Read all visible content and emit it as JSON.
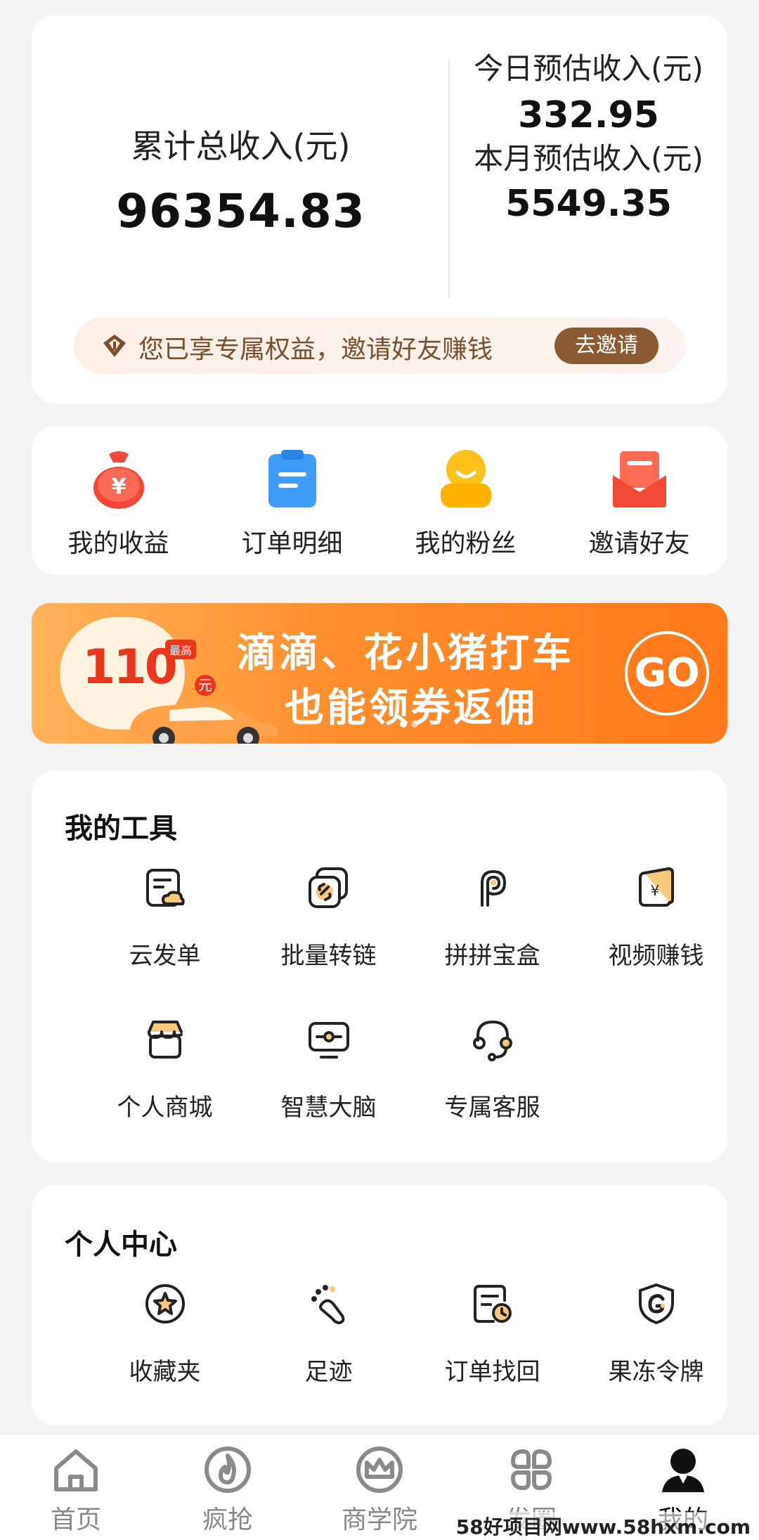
{
  "earnings": {
    "total_label": "累计总收入(元)",
    "total_value": "96354.83",
    "today_label": "今日预估收入(元)",
    "today_value": "332.95",
    "month_label": "本月预估收入(元)",
    "month_value": "5549.35"
  },
  "perk": {
    "text": "您已享专属权益，邀请好友赚钱",
    "button": "去邀请"
  },
  "quick_entries": [
    {
      "label": "我的收益",
      "icon": "money-bag-icon"
    },
    {
      "label": "订单明细",
      "icon": "clipboard-icon"
    },
    {
      "label": "我的粉丝",
      "icon": "fan-person-icon"
    },
    {
      "label": "邀请好友",
      "icon": "envelope-icon"
    }
  ],
  "banner": {
    "amount": "110",
    "amount_prefix": "最高",
    "amount_unit": "元",
    "line1": "滴滴、花小猪打车",
    "line2": "也能领券返佣",
    "go": "GO"
  },
  "tools": {
    "title": "我的工具",
    "items": [
      {
        "label": "云发单",
        "icon": "cloud-order-icon"
      },
      {
        "label": "批量转链",
        "icon": "batch-link-icon"
      },
      {
        "label": "拼拼宝盒",
        "icon": "p-box-icon"
      },
      {
        "label": "视频赚钱",
        "icon": "video-earn-icon"
      },
      {
        "label": "个人商城",
        "icon": "shop-icon"
      },
      {
        "label": "智慧大脑",
        "icon": "smart-brain-icon"
      },
      {
        "label": "专属客服",
        "icon": "headset-icon"
      }
    ]
  },
  "personal": {
    "title": "个人中心",
    "items": [
      {
        "label": "收藏夹",
        "icon": "star-favorite-icon"
      },
      {
        "label": "足迹",
        "icon": "footprint-icon"
      },
      {
        "label": "订单找回",
        "icon": "order-recover-icon"
      },
      {
        "label": "果冻令牌",
        "icon": "token-shield-icon"
      }
    ]
  },
  "nav": {
    "items": [
      {
        "label": "首页",
        "icon": "home-icon"
      },
      {
        "label": "疯抢",
        "icon": "flame-icon"
      },
      {
        "label": "商学院",
        "icon": "crown-icon"
      },
      {
        "label": "发圈",
        "icon": "grid-share-icon"
      },
      {
        "label": "我的",
        "icon": "profile-icon"
      }
    ],
    "active_index": 4
  },
  "watermark": "58好项目网www.58hxm.com"
}
